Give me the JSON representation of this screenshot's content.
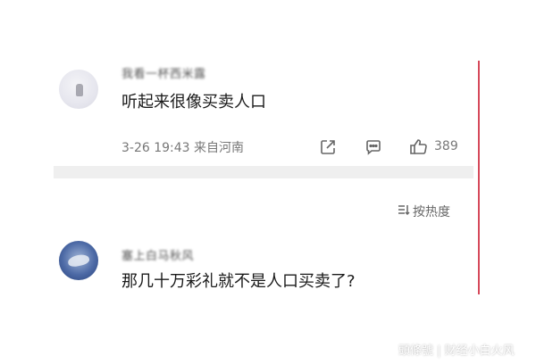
{
  "comment1": {
    "username": "我看一杯西米露",
    "text": "听起来很像买卖人口",
    "meta": "3-26 19:43 来自河南",
    "like_count": "389",
    "icons": [
      "share-icon",
      "comment-icon",
      "like-icon"
    ]
  },
  "sort": {
    "icon": "sort-icon",
    "label": "按热度"
  },
  "comment2": {
    "username": "塞上白马秋风",
    "text": "那几十万彩礼就不是人口买卖了?"
  },
  "watermark": {
    "text": "頭條號 | 财经小白火风"
  },
  "colors": {
    "red_line": "#d6495a",
    "divider": "#efefef"
  }
}
